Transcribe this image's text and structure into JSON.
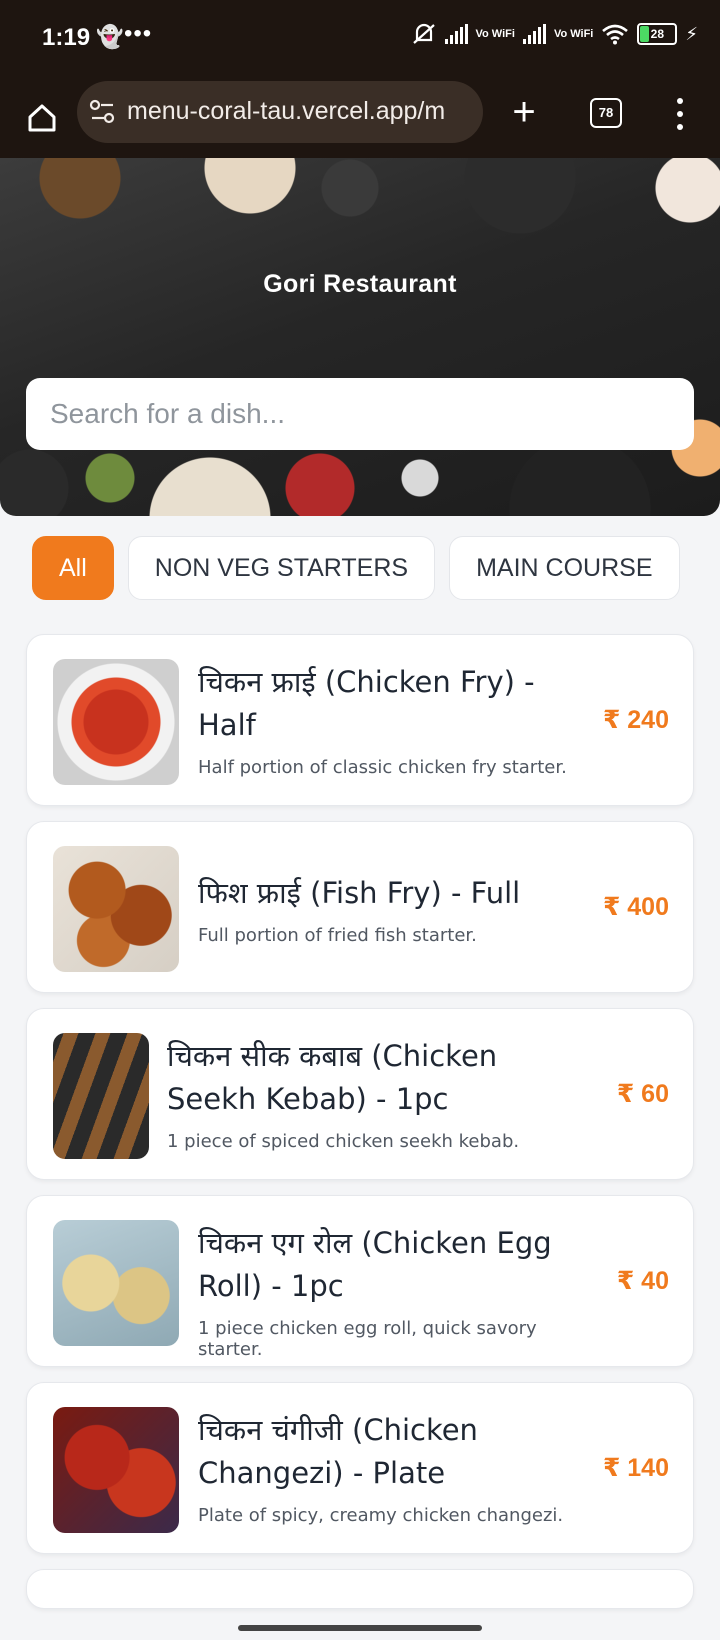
{
  "status_bar": {
    "time": "1:19",
    "battery": "28",
    "vowifi_1": "Vo WiFi",
    "vowifi_2": "Vo WiFi"
  },
  "browser": {
    "url": "menu-coral-tau.vercel.app/m",
    "tab_count": "78"
  },
  "hero": {
    "title": "Gori Restaurant",
    "search_placeholder": "Search for a dish..."
  },
  "categories": [
    {
      "label": "All",
      "active": true
    },
    {
      "label": "NON VEG STARTERS",
      "active": false
    },
    {
      "label": "MAIN COURSE",
      "active": false
    }
  ],
  "items": [
    {
      "name": "चिकन फ्राई (Chicken Fry) - Half",
      "description": "Half portion of classic chicken fry starter.",
      "price": "₹ 240"
    },
    {
      "name": "फिश फ्राई (Fish Fry) - Full",
      "description": "Full portion of fried fish starter.",
      "price": "₹ 400"
    },
    {
      "name": "चिकन सीक कबाब (Chicken Seekh Kebab) - 1pc",
      "description": "1 piece of spiced chicken seekh kebab.",
      "price": "₹ 60"
    },
    {
      "name": "चिकन एग रोल (Chicken Egg Roll) - 1pc",
      "description": "1 piece chicken egg roll, quick savory starter.",
      "price": "₹ 40"
    },
    {
      "name": "चिकन चंगीजी (Chicken Changezi) - Plate",
      "description": "Plate of spicy, creamy chicken changezi.",
      "price": "₹ 140"
    }
  ],
  "colors": {
    "accent": "#f07a1d",
    "browser_bar": "#1e1510"
  }
}
